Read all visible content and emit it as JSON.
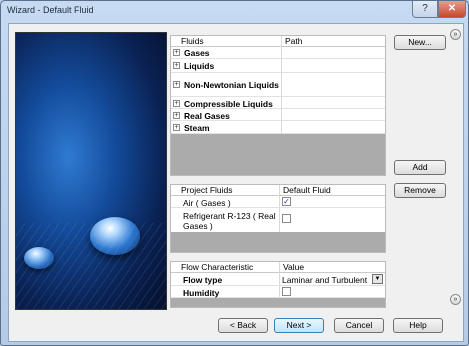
{
  "window": {
    "title": "Wizard - Default Fluid",
    "help_label": "?",
    "close_label": "✕"
  },
  "fluids_table": {
    "headers": {
      "name": "Fluids",
      "path": "Path"
    },
    "rows": [
      {
        "label": "Gases",
        "expander": "+"
      },
      {
        "label": "Liquids",
        "expander": "+"
      },
      {
        "label": "Non-Newtonian Liquids",
        "expander": "+"
      },
      {
        "label": "Compressible Liquids",
        "expander": "+"
      },
      {
        "label": "Real Gases",
        "expander": "+"
      },
      {
        "label": "Steam",
        "expander": "+"
      }
    ]
  },
  "project_fluids": {
    "headers": {
      "name": "Project Fluids",
      "default": "Default Fluid"
    },
    "rows": [
      {
        "line1": "Air ( Gases )",
        "line2": "",
        "checked": true,
        "check_mark": "✓"
      },
      {
        "line1": "Refrigerant R-123 ( Real",
        "line2": "Gases )",
        "checked": false,
        "check_mark": ""
      }
    ]
  },
  "flow_table": {
    "headers": {
      "name": "Flow Characteristic",
      "value": "Value"
    },
    "rows": [
      {
        "label": "Flow type",
        "value": "Laminar and Turbulent",
        "dropdown_arrow": "▼"
      },
      {
        "label": "Humidity",
        "value": "",
        "checked": false
      }
    ]
  },
  "buttons": {
    "new": "New...",
    "add": "Add",
    "remove": "Remove",
    "back": "< Back",
    "next": "Next >",
    "cancel": "Cancel",
    "help": "Help"
  },
  "collapse_icons": {
    "top": "»",
    "bottom": "»"
  }
}
